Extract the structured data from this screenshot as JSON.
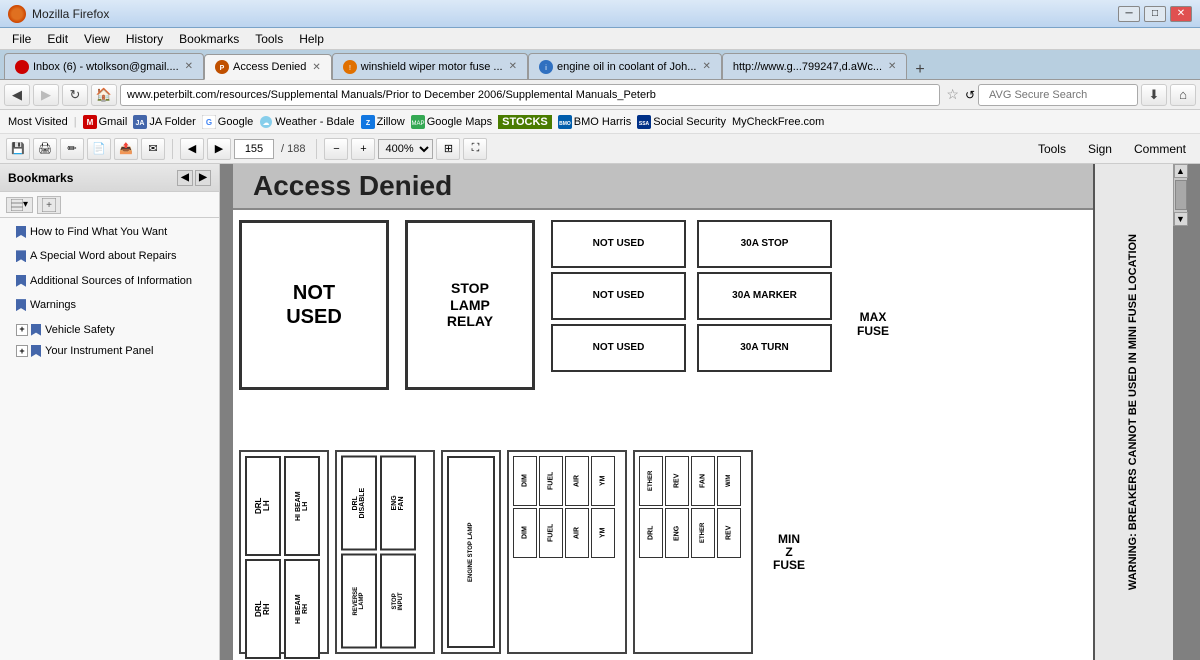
{
  "titlebar": {
    "title": "Mozilla Firefox",
    "minimize": "─",
    "maximize": "□",
    "close": "✕"
  },
  "menubar": {
    "items": [
      "File",
      "Edit",
      "View",
      "History",
      "Bookmarks",
      "Tools",
      "Help"
    ]
  },
  "tabs": [
    {
      "id": "gmail",
      "label": "Inbox (6) - wtolkson@gmail....",
      "active": false,
      "icon": "gmail"
    },
    {
      "id": "peterbilt",
      "label": "Access Denied",
      "active": true,
      "icon": "peterbilt"
    },
    {
      "id": "wiper",
      "label": "winshield wiper motor fuse ...",
      "active": false,
      "icon": "wiper"
    },
    {
      "id": "oil",
      "label": "engine oil in coolant of Joh...",
      "active": false,
      "icon": "oil"
    },
    {
      "id": "url5",
      "label": "http://www.g...799247,d.aWc...",
      "active": false,
      "icon": "url"
    }
  ],
  "navbar": {
    "back_enabled": true,
    "forward_enabled": false,
    "url": "www.peterbilt.com/resources/Supplemental Manuals/Prior to December 2006/Supplemental Manuals_Peterb",
    "search_placeholder": "AVG Secure Search"
  },
  "bookmarks": [
    {
      "label": "Most Visited",
      "type": "text"
    },
    {
      "label": "Gmail",
      "type": "icon-g"
    },
    {
      "label": "JA Folder",
      "type": "icon-j"
    },
    {
      "label": "Google",
      "type": "icon-google"
    },
    {
      "label": "Weather - Bdale",
      "type": "icon"
    },
    {
      "label": "Zillow",
      "type": "icon"
    },
    {
      "label": "Google Maps",
      "type": "icon"
    },
    {
      "label": "STOCKS",
      "type": "icon"
    },
    {
      "label": "BMO Harris",
      "type": "icon"
    },
    {
      "label": "Social Security",
      "type": "icon"
    },
    {
      "label": "MyCheckFree.com",
      "type": "text"
    }
  ],
  "pdf_toolbar": {
    "page_current": "155",
    "page_total": "188",
    "zoom": "400%",
    "tools_label": "Tools",
    "sign_label": "Sign",
    "comment_label": "Comment"
  },
  "sidebar": {
    "title": "Bookmarks",
    "items": [
      {
        "id": "how-to-find",
        "label": "How to Find What You Want",
        "type": "bookmark",
        "level": 0
      },
      {
        "id": "special-word",
        "label": "A Special Word about Repairs",
        "type": "bookmark",
        "level": 0
      },
      {
        "id": "additional",
        "label": "Additional Sources of Information",
        "type": "bookmark",
        "level": 0
      },
      {
        "id": "warnings",
        "label": "Warnings",
        "type": "bookmark",
        "level": 0
      },
      {
        "id": "vehicle-safety",
        "label": "Vehicle Safety",
        "type": "folder-expand",
        "level": 0
      },
      {
        "id": "instrument-panel",
        "label": "Your Instrument Panel",
        "type": "folder-expand",
        "level": 0
      }
    ]
  },
  "fuse_diagram": {
    "access_denied_title": "Access Denied",
    "top_boxes": [
      {
        "id": "not-used-1",
        "label": "NOT\nUSED",
        "row": 1,
        "col": 1
      },
      {
        "id": "stop-lamp-relay",
        "label": "STOP\nLAMP\nRELAY",
        "row": 1,
        "col": 2
      },
      {
        "id": "not-used-a",
        "label": "NOT USED",
        "row": 1,
        "col": 3
      },
      {
        "id": "30a-stop",
        "label": "30A STOP",
        "row": 1,
        "col": 4
      }
    ],
    "not_used_col": [
      "NOT USED",
      "NOT  USED",
      "NOT  USED"
    ],
    "right_col": [
      "30A STOP",
      "30A MARKER",
      "30A TURN"
    ],
    "warning_text": "WARNING: BREAKERS CANNOT BE USED IN MINI FUSE LOCATION",
    "max_fuse": "MAX\nFUSE",
    "min_fuse": "MIN\nFUSE",
    "bottom_cells": [
      "DRL\nLH",
      "HI BEAM\nLH",
      "DRL\nDISABLE",
      "ENG\nFAN",
      "DRL\nRH",
      "HI BEAM\nRH",
      "REVERSE\nLAMP",
      "STOP INPUT",
      "ENGINE STOP LAMP",
      "DIM",
      "FUEL",
      "AIR",
      "YM",
      "ETHER",
      "REV",
      "FAN",
      "W/M",
      "DRL",
      "ENG"
    ]
  }
}
